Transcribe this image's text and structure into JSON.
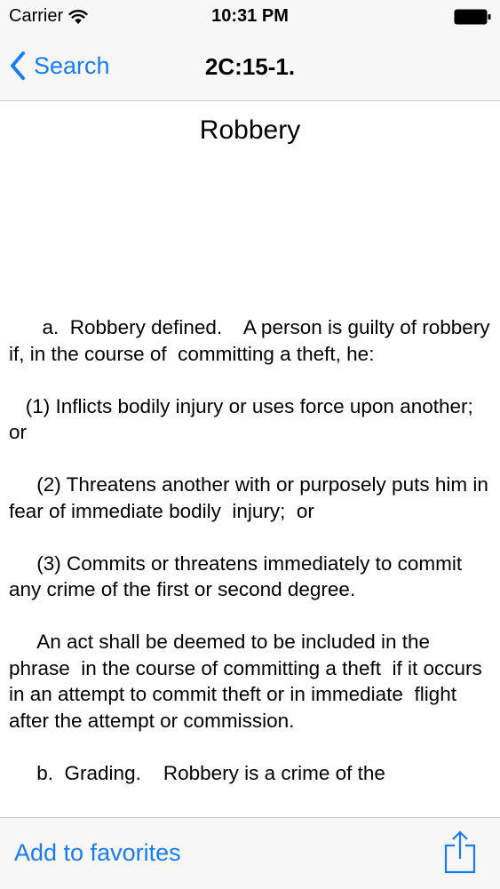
{
  "status_bar": {
    "carrier": "Carrier",
    "time": "10:31 PM",
    "wifi_icon": "wifi-icon",
    "battery_icon": "battery-icon"
  },
  "nav": {
    "back_label": "Search",
    "back_icon": "chevron-left-icon",
    "title": "2C:15-1."
  },
  "document": {
    "heading": "Robbery",
    "paragraphs": [
      "      a.  Robbery defined.    A person is guilty of robbery if, in the course of  committing a theft, he:",
      "   (1) Inflicts bodily injury or uses force upon another;  or",
      "     (2) Threatens another with or purposely puts him in fear of immediate bodily  injury;  or",
      "     (3) Commits or threatens immediately to commit any crime of the first or second degree.",
      "     An act shall be deemed to be included in the phrase  in the course of committing a theft  if it occurs in an attempt to commit theft or in immediate  flight after the attempt or commission.",
      "     b.  Grading.    Robbery is a crime of the"
    ]
  },
  "toolbar": {
    "favorites_label": "Add to favorites",
    "share_icon": "share-icon"
  },
  "colors": {
    "accent": "#1a7cf5",
    "bar_background": "#f7f7f7",
    "separator": "#c8c7cc"
  }
}
